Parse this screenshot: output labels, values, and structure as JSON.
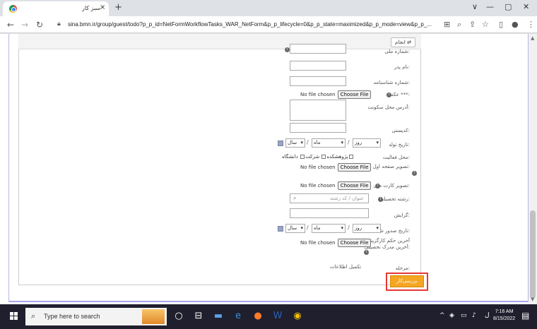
{
  "browser": {
    "tab_title": "سبز کار",
    "tab_close": "×",
    "new_tab": "+",
    "url": "sina.bmn.ir/group/guest/todo?p_p_id=NetFormWorkflowTasks_WAR_NetForm&p_p_lifecycle=0&p_p_state=maximized&p_p_mode=view&p_p_...",
    "window_controls": [
      "∨",
      "—",
      "▢",
      "✕"
    ]
  },
  "page": {
    "finish_label": "انجام",
    "fields": {
      "id_number": "شماره ملی:",
      "father_name": "نام پدر:",
      "birth_cert": "شماره شناسنامه:",
      "photo": "عکس ***:",
      "address": "آدرس محل سکونت:",
      "postal": "کدپستی:",
      "birth_date": "تاریخ تولد:",
      "activity": "محل فعالیت:",
      "id_page": "تصویر صفحه اول شناسنامه:",
      "card": "تصویر کارت ملی:",
      "major": "رشته تحصیلی:",
      "orientation": "گرایش:",
      "issue_date": "تاریخ صدور شناسنامه:",
      "last_degree": "آخرین حکم کارگزینی یا آخرین مدرک تحصیلی:"
    },
    "file_none": "No file chosen",
    "choose_file": "Choose File",
    "date": {
      "day": "روز",
      "month": "ماه",
      "year": "سال",
      "sep": "/"
    },
    "activity_options": [
      "دانشگاه",
      "شرکت",
      "پژوهشکده"
    ],
    "major_placeholder": "عنوان / کد رشته",
    "stage_label": "مرحله:",
    "stage_value": "تکمیل اطلاعات",
    "review_button": "بررسی‌کار"
  },
  "taskbar": {
    "search_placeholder": "Type here to search",
    "time": "7:16 AM",
    "date": "8/15/2022"
  }
}
